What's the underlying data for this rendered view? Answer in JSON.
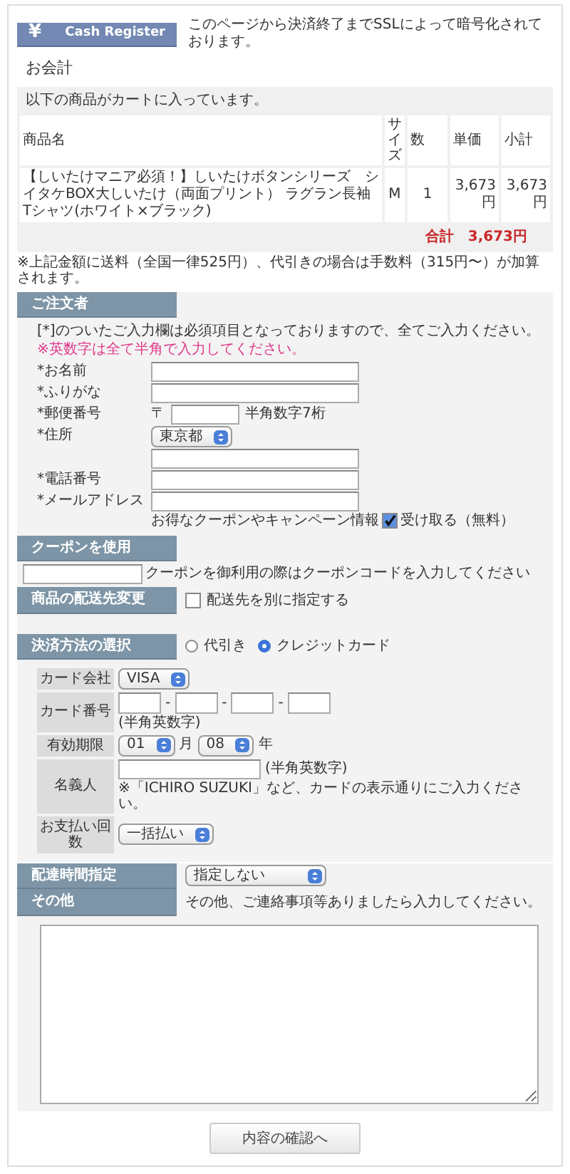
{
  "header": {
    "logo_symbol": "¥",
    "logo_text": "Cash Register",
    "ssl_notice": "このページから決済終了までSSLによって暗号化されております。"
  },
  "page_title": "お会計",
  "cart": {
    "caption": "以下の商品がカートに入っています。",
    "columns": [
      "商品名",
      "サイズ",
      "数",
      "単価",
      "小計"
    ],
    "rows": [
      {
        "cells": [
          "【しいたけマニア必須！】しいたけボタンシリーズ　シイタケBOX大しいたけ（両面プリント） ラグラン長袖Tシャツ(ホワイト×ブラック)",
          "M",
          "1",
          "3,673円",
          "3,673円"
        ]
      }
    ],
    "total_label": "合計",
    "total_value": "3,673円"
  },
  "shipping_note": "※上記金額に送料（全国一律525円）、代引きの場合は手数料（315円〜）が加算されます。",
  "orderer": {
    "heading": "ご注文者",
    "notice": "[*]のついたご入力欄は必須項目となっておりますので、全てご入力ください。",
    "warning": "※英数字は全て半角で入力してください。",
    "fields": [
      {
        "kind": "text",
        "label": "*お名前"
      },
      {
        "kind": "text",
        "label": "*ふりがな"
      },
      {
        "kind": "postal",
        "label": "*郵便番号",
        "prefix": "〒",
        "hint": "半角数字7桁"
      },
      {
        "kind": "select",
        "label": "*住所",
        "value": "東京都"
      },
      {
        "kind": "text"
      },
      {
        "kind": "text",
        "label": "*電話番号"
      },
      {
        "kind": "email",
        "label": "*メールアドレス",
        "optin": {
          "text": "お得なクーポンやキャンペーン情報",
          "checkbox_label": "受け取る（無料）",
          "checked": true
        }
      }
    ]
  },
  "coupon": {
    "heading": "クーポンを使用",
    "hint": "クーポンを御利用の際はクーポンコードを入力してください"
  },
  "delivery_change": {
    "heading": "商品の配送先変更",
    "checkbox_label": "配送先を別に指定する",
    "checked": false
  },
  "payment": {
    "heading": "決済方法の選択",
    "options": [
      {
        "label": "代引き",
        "selected": false
      },
      {
        "label": "クレジットカード",
        "selected": true
      }
    ]
  },
  "card": {
    "company": {
      "label": "カード会社",
      "value": "VISA"
    },
    "number": {
      "label": "カード番号",
      "separators": [
        "-",
        "-",
        "-"
      ],
      "hint": "(半角英数字)"
    },
    "expiry": {
      "label": "有効期限",
      "month": "01",
      "month_unit": "月",
      "year": "08",
      "year_unit": "年"
    },
    "holder": {
      "label": "名義人",
      "hint": "(半角英数字)",
      "note": "※「ICHIRO SUZUKI」など、カードの表示通りにご入力ください。"
    },
    "installments": {
      "label": "お支払い回数",
      "value": "一括払い"
    }
  },
  "delivery_time": {
    "heading": "配達時間指定",
    "value": "指定しない"
  },
  "other": {
    "heading": "その他",
    "hint": "その他、ご連絡事項等ありましたら入力してください。"
  },
  "submit": "内容の確認へ"
}
